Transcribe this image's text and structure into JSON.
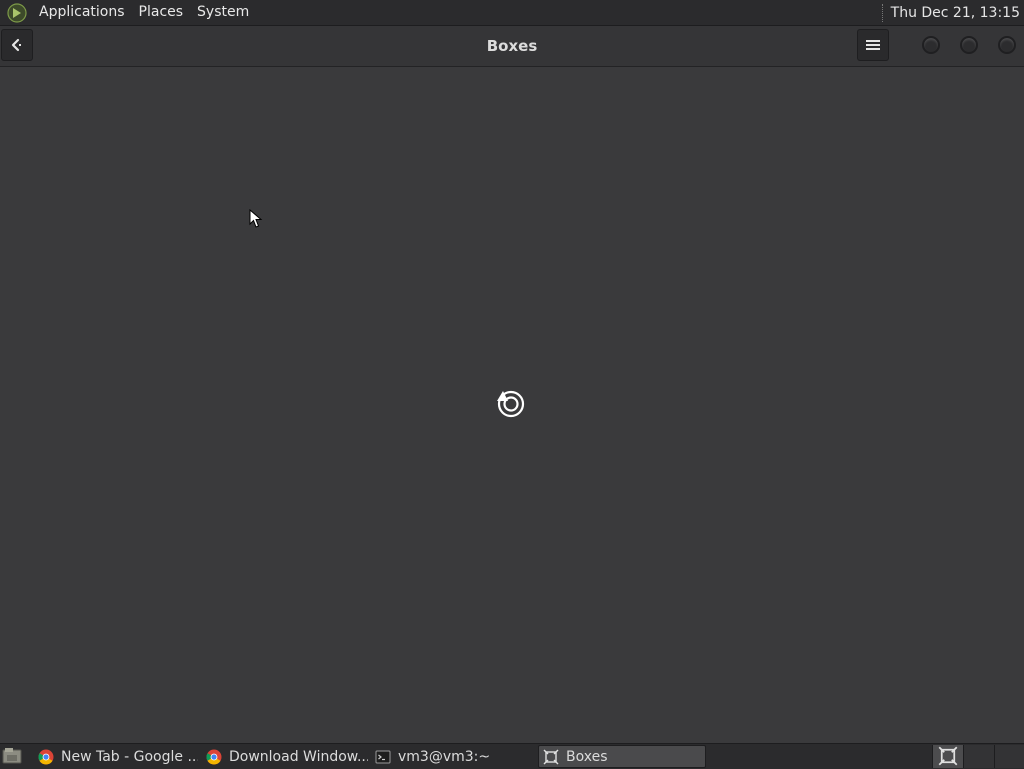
{
  "top_panel": {
    "menus": [
      "Applications",
      "Places",
      "System"
    ],
    "clock": "Thu Dec 21, 13:15"
  },
  "header": {
    "title": "Boxes",
    "back_icon": "back-arrow-icon",
    "menu_icon": "hamburger-menu-icon"
  },
  "content": {
    "status_icon": "loading-spinner-icon"
  },
  "taskbar": {
    "tasks": [
      {
        "label": "New Tab - Google ...",
        "icon": "chrome-icon",
        "active": false
      },
      {
        "label": "Download Window...",
        "icon": "chrome-icon",
        "active": false
      },
      {
        "label": "vm3@vm3:~",
        "icon": "terminal-icon",
        "active": false
      },
      {
        "label": "Boxes",
        "icon": "boxes-icon",
        "active": true
      }
    ]
  },
  "colors": {
    "panel_bg": "#2b2b2d",
    "header_bg": "#353537",
    "content_bg": "#3a3a3c",
    "text": "#e6e6e6"
  }
}
